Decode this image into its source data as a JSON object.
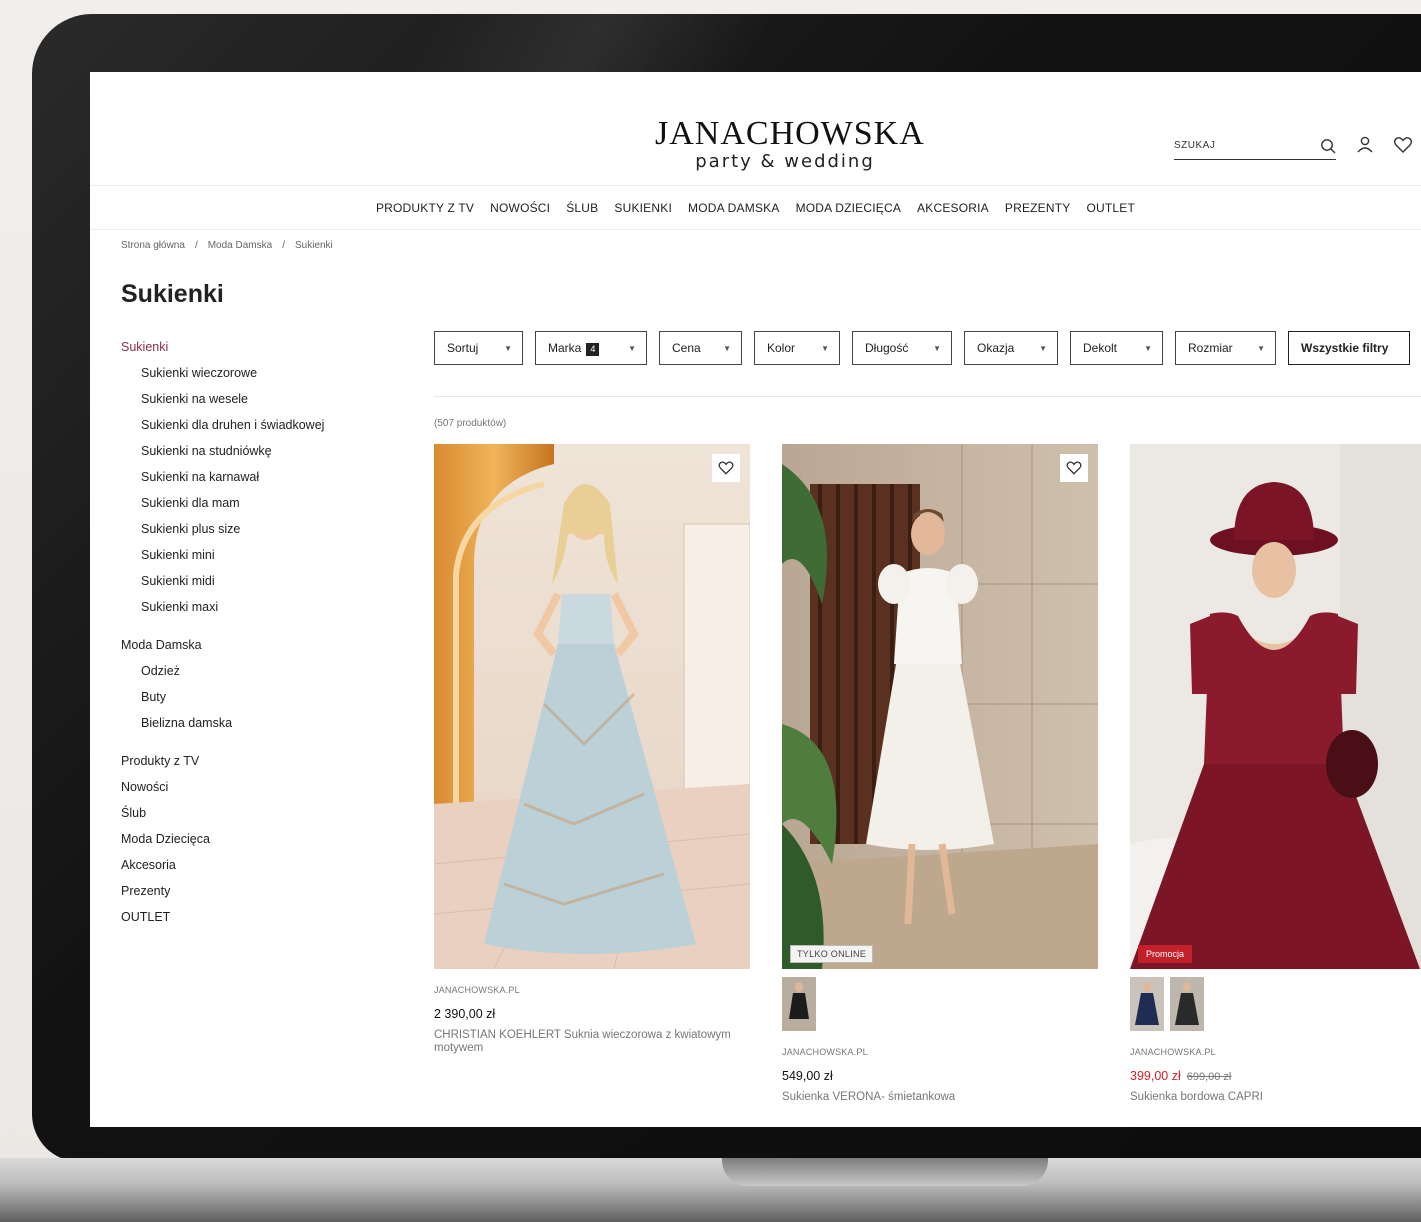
{
  "brand": {
    "name": "JANACHOWSKA",
    "tagline": "party & wedding"
  },
  "search": {
    "placeholder": "SZUKAJ"
  },
  "icons": {
    "search": "search-icon",
    "account": "user-icon",
    "wishlist": "heart-icon"
  },
  "nav": [
    "PRODUKTY Z TV",
    "NOWOŚCI",
    "ŚLUB",
    "SUKIENKI",
    "MODA DAMSKA",
    "MODA DZIECIĘCA",
    "AKCESORIA",
    "PREZENTY",
    "OUTLET"
  ],
  "breadcrumb": [
    "Strona główna",
    "/",
    "Moda Damska",
    "/",
    "Sukienki"
  ],
  "page_title": "Sukienki",
  "sidebar": {
    "active": "Sukienki",
    "sukienki_sub": [
      "Sukienki wieczorowe",
      "Sukienki na wesele",
      "Sukienki dla druhen i świadkowej",
      "Sukienki na studniówkę",
      "Sukienki na karnawał",
      "Sukienki dla mam",
      "Sukienki plus size",
      "Sukienki mini",
      "Sukienki midi",
      "Sukienki maxi"
    ],
    "moda_damska": "Moda Damska",
    "moda_damska_sub": [
      "Odzież",
      "Buty",
      "Bielizna damska"
    ],
    "other": [
      "Produkty z TV",
      "Nowości",
      "Ślub",
      "Moda Dziecięca",
      "Akcesoria",
      "Prezenty",
      "OUTLET"
    ]
  },
  "filters": {
    "sort": "Sortuj",
    "brand": "Marka",
    "brand_count": "4",
    "price": "Cena",
    "color": "Kolor",
    "length": "Długość",
    "occasion": "Okazja",
    "neckline": "Dekolt",
    "size": "Rozmiar",
    "all": "Wszystkie filtry"
  },
  "product_count": "(507 produktów)",
  "products": [
    {
      "brand": "JANACHOWSKA.PL",
      "price": "2 390,00 zł",
      "name": "CHRISTIAN KOEHLERT Suknia wieczorowa z kwiatowym motywem",
      "badge": "",
      "dress_color": "#b9cdd6"
    },
    {
      "brand": "JANACHOWSKA.PL",
      "price": "549,00 zł",
      "name": "Sukienka VERONA- śmietankowa",
      "badge": "TYLKO ONLINE",
      "dress_color": "#f4f2ee"
    },
    {
      "brand": "JANACHOWSKA.PL",
      "price": "399,00 zł",
      "old_price": "699,00 zł",
      "name": "Sukienka bordowa CAPRI",
      "badge": "Promocja",
      "dress_color": "#7a1426"
    }
  ]
}
